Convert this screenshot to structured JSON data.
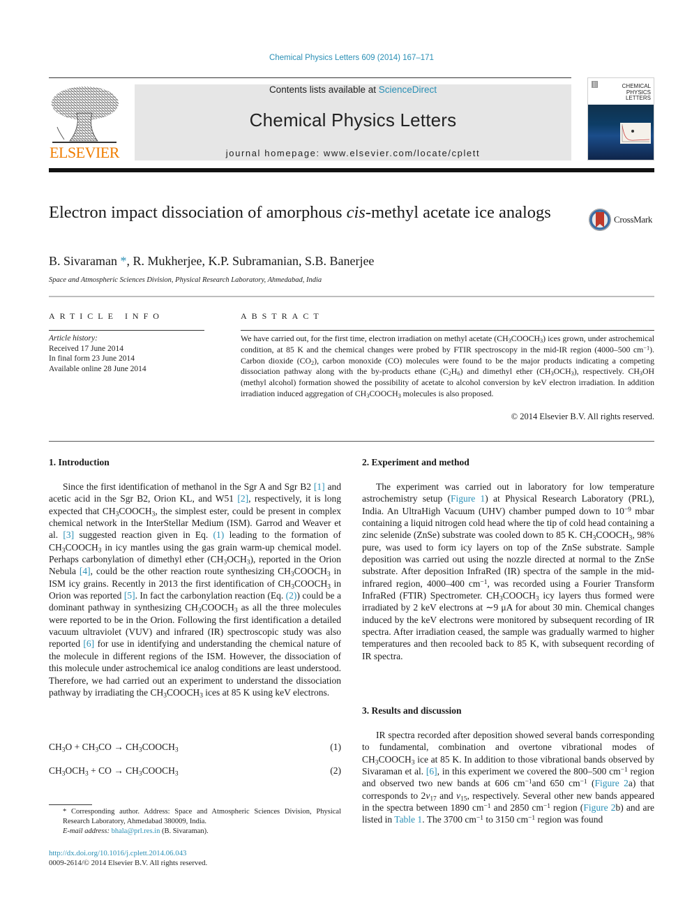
{
  "header": {
    "journal_citation": "Chemical Physics Letters 609 (2014) 167–171",
    "contents_prefix": "Contents lists available at ",
    "contents_link": "ScienceDirect",
    "journal_title": "Chemical Physics Letters",
    "homepage": "journal homepage: www.elsevier.com/locate/cplett",
    "publisher_logo_text": "ELSEVIER",
    "cover_title": "CHEMICAL\nPHYSICS\nLETTERS",
    "colors": {
      "link": "#2a8fb5",
      "elsevier_orange": "#f07d00",
      "masthead_bg": "#e6e6e6"
    }
  },
  "article": {
    "title": [
      {
        "t": "Electron impact dissociation of amorphous "
      },
      {
        "t": "cis",
        "i": true
      },
      {
        "t": "-methyl acetate ice analogs"
      }
    ],
    "crossmark_label": "CrossMark",
    "authors": [
      {
        "t": "B. Sivaraman"
      },
      {
        "t": " *",
        "link": true
      },
      {
        "t": ", R. Mukherjee, K.P. Subramanian, S.B. Banerjee"
      }
    ],
    "affiliation": "Space and Atmospheric Sciences Division, Physical Research Laboratory, Ahmedabad, India"
  },
  "article_info": {
    "heading": "ARTICLE INFO",
    "history_label": "Article history:",
    "history": [
      "Received 17 June 2014",
      "In final form 23 June 2014",
      "Available online 28 June 2014"
    ]
  },
  "abstract": {
    "heading": "ABSTRACT",
    "body": [
      {
        "t": "We have carried out, for the first time, electron irradiation on methyl acetate (CH"
      },
      {
        "t": "3",
        "sub": true
      },
      {
        "t": "COOCH"
      },
      {
        "t": "3",
        "sub": true
      },
      {
        "t": ") ices grown, under astrochemical condition, at 85 K and the chemical changes were probed by FTIR spectroscopy in the mid-IR region (4000–500 cm"
      },
      {
        "t": "−1",
        "sup": true
      },
      {
        "t": "). Carbon dioxide (CO"
      },
      {
        "t": "2",
        "sub": true
      },
      {
        "t": "), carbon monoxide (CO) molecules were found to be the major products indicating a competing dissociation pathway along with the by-products ethane (C"
      },
      {
        "t": "2",
        "sub": true
      },
      {
        "t": "H"
      },
      {
        "t": "6",
        "sub": true
      },
      {
        "t": ") and dimethyl ether (CH"
      },
      {
        "t": "3",
        "sub": true
      },
      {
        "t": "OCH"
      },
      {
        "t": "3",
        "sub": true
      },
      {
        "t": "), respectively. CH"
      },
      {
        "t": "3",
        "sub": true
      },
      {
        "t": "OH (methyl alcohol) formation showed the possibility of acetate to alcohol conversion by keV electron irradiation. In addition irradiation induced aggregation of CH"
      },
      {
        "t": "3",
        "sub": true
      },
      {
        "t": "COOCH"
      },
      {
        "t": "3",
        "sub": true
      },
      {
        "t": " molecules is also proposed."
      }
    ],
    "copyright": "© 2014 Elsevier B.V. All rights reserved."
  },
  "sections": {
    "introduction": {
      "heading": "1. Introduction",
      "body": [
        {
          "t": "Since the first identification of methanol in the Sgr A and Sgr B2 "
        },
        {
          "t": "[1]",
          "link": true
        },
        {
          "t": " and acetic acid in the Sgr B2, Orion KL, and W51 "
        },
        {
          "t": "[2]",
          "link": true
        },
        {
          "t": ", respectively, it is long expected that CH"
        },
        {
          "t": "3",
          "sub": true
        },
        {
          "t": "COOCH"
        },
        {
          "t": "3",
          "sub": true
        },
        {
          "t": ", the simplest ester, could be present in complex chemical network in the InterStellar Medium (ISM). Garrod and Weaver et al. "
        },
        {
          "t": "[3]",
          "link": true
        },
        {
          "t": " suggested reaction given in Eq. "
        },
        {
          "t": "(1)",
          "link": true
        },
        {
          "t": " leading to the formation of CH"
        },
        {
          "t": "3",
          "sub": true
        },
        {
          "t": "COOCH"
        },
        {
          "t": "3",
          "sub": true
        },
        {
          "t": " in icy mantles using the gas grain warm-up chemical model. Perhaps carbonylation of dimethyl ether (CH"
        },
        {
          "t": "3",
          "sub": true
        },
        {
          "t": "OCH"
        },
        {
          "t": "3",
          "sub": true
        },
        {
          "t": "), reported in the Orion Nebula "
        },
        {
          "t": "[4]",
          "link": true
        },
        {
          "t": ", could be the other reaction route synthesizing CH"
        },
        {
          "t": "3",
          "sub": true
        },
        {
          "t": "COOCH"
        },
        {
          "t": "3",
          "sub": true
        },
        {
          "t": " in ISM icy grains. Recently in 2013 the first identification of CH"
        },
        {
          "t": "3",
          "sub": true
        },
        {
          "t": "COOCH"
        },
        {
          "t": "3",
          "sub": true
        },
        {
          "t": " in Orion was reported "
        },
        {
          "t": "[5]",
          "link": true
        },
        {
          "t": ". In fact the carbonylation reaction (Eq. "
        },
        {
          "t": "(2)",
          "link": true
        },
        {
          "t": ") could be a dominant pathway in synthesizing CH"
        },
        {
          "t": "3",
          "sub": true
        },
        {
          "t": "COOCH"
        },
        {
          "t": "3",
          "sub": true
        },
        {
          "t": " as all the three molecules were reported to be in the Orion. Following the first identification a detailed vacuum ultraviolet (VUV) and infrared (IR) spectroscopic study was also reported "
        },
        {
          "t": "[6]",
          "link": true
        },
        {
          "t": " for use in identifying and understanding the chemical nature of the molecule in different regions of the ISM. However, the dissociation of this molecule under astrochemical ice analog conditions are least understood. Therefore, we had carried out an experiment to understand the dissociation pathway by irradiating the CH"
        },
        {
          "t": "3",
          "sub": true
        },
        {
          "t": "COOCH"
        },
        {
          "t": "3",
          "sub": true
        },
        {
          "t": " ices at 85 K using keV electrons."
        }
      ],
      "equations": [
        {
          "expr": [
            {
              "t": "CH"
            },
            {
              "t": "3",
              "sub": true
            },
            {
              "t": "O + CH"
            },
            {
              "t": "3",
              "sub": true
            },
            {
              "t": "CO  →  CH"
            },
            {
              "t": "3",
              "sub": true
            },
            {
              "t": "COOCH"
            },
            {
              "t": "3",
              "sub": true
            }
          ],
          "number": "(1)"
        },
        {
          "expr": [
            {
              "t": "CH"
            },
            {
              "t": "3",
              "sub": true
            },
            {
              "t": "OCH"
            },
            {
              "t": "3",
              "sub": true
            },
            {
              "t": " + CO  →  CH"
            },
            {
              "t": "3",
              "sub": true
            },
            {
              "t": "COOCH"
            },
            {
              "t": "3",
              "sub": true
            }
          ],
          "number": "(2)"
        }
      ]
    },
    "experiment": {
      "heading": "2. Experiment and method",
      "body": [
        {
          "t": "The experiment was carried out in laboratory for low temperature astrochemistry setup ("
        },
        {
          "t": "Figure 1",
          "link": true
        },
        {
          "t": ") at Physical Research Laboratory (PRL), India. An UltraHigh Vacuum (UHV) chamber pumped down to 10"
        },
        {
          "t": "−9",
          "sup": true
        },
        {
          "t": " mbar containing a liquid nitrogen cold head where the tip of cold head containing a zinc selenide (ZnSe) substrate was cooled down to 85 K. CH"
        },
        {
          "t": "3",
          "sub": true
        },
        {
          "t": "COOCH"
        },
        {
          "t": "3",
          "sub": true
        },
        {
          "t": ", 98% pure, was used to form icy layers on top of the ZnSe substrate. Sample deposition was carried out using the nozzle directed at normal to the ZnSe substrate. After deposition InfraRed (IR) spectra of the sample in the mid-infrared region, 4000–400 cm"
        },
        {
          "t": "−1",
          "sup": true
        },
        {
          "t": ", was recorded using a Fourier Transform InfraRed (FTIR) Spectrometer. CH"
        },
        {
          "t": "3",
          "sub": true
        },
        {
          "t": "COOCH"
        },
        {
          "t": "3",
          "sub": true
        },
        {
          "t": " icy layers thus formed were irradiated by 2 keV electrons at ∼9 μA for about 30 min. Chemical changes induced by the keV electrons were monitored by subsequent recording of IR spectra. After irradiation ceased, the sample was gradually warmed to higher temperatures and then recooled back to 85 K, with subsequent recording of IR spectra."
        }
      ]
    },
    "results": {
      "heading": "3. Results and discussion",
      "body": [
        {
          "t": "IR spectra recorded after deposition showed several bands corresponding to fundamental, combination and overtone vibrational modes of CH"
        },
        {
          "t": "3",
          "sub": true
        },
        {
          "t": "COOCH"
        },
        {
          "t": "3",
          "sub": true
        },
        {
          "t": " ice at 85 K. In addition to those vibrational bands observed by Sivaraman et al. "
        },
        {
          "t": "[6]",
          "link": true
        },
        {
          "t": ", in this experiment we covered the 800–500 cm"
        },
        {
          "t": "−1",
          "sup": true
        },
        {
          "t": " region and observed two new bands at 606 cm"
        },
        {
          "t": "−1",
          "sup": true
        },
        {
          "t": "and 650 cm"
        },
        {
          "t": "−1",
          "sup": true
        },
        {
          "t": " ("
        },
        {
          "t": "Figure 2",
          "link": true
        },
        {
          "t": "a) that corresponds to 2"
        },
        {
          "t": "ν",
          "i": true
        },
        {
          "t": "17",
          "sub": true
        },
        {
          "t": " and "
        },
        {
          "t": "ν",
          "i": true
        },
        {
          "t": "15",
          "sub": true
        },
        {
          "t": ", respectively. Several other new bands appeared in the spectra between 1890 cm"
        },
        {
          "t": "−1",
          "sup": true
        },
        {
          "t": " and 2850 cm"
        },
        {
          "t": "−1",
          "sup": true
        },
        {
          "t": " region ("
        },
        {
          "t": "Figure 2",
          "link": true
        },
        {
          "t": "b) and are listed in "
        },
        {
          "t": "Table 1",
          "link": true
        },
        {
          "t": ". The 3700 cm"
        },
        {
          "t": "−1",
          "sup": true
        },
        {
          "t": " to 3150 cm"
        },
        {
          "t": "−1",
          "sup": true
        },
        {
          "t": " region was found"
        }
      ]
    }
  },
  "footnote": {
    "corresponding": "* Corresponding author. Address: Space and Atmospheric Sciences Division, Physical Research Laboratory, Ahmedabad 380009, India.",
    "email_label": "E-mail address: ",
    "email": "bhala@prl.res.in",
    "email_suffix": " (B. Sivaraman).",
    "doi": "http://dx.doi.org/10.1016/j.cplett.2014.06.043",
    "issn_copyright": "0009-2614/© 2014 Elsevier B.V. All rights reserved."
  }
}
